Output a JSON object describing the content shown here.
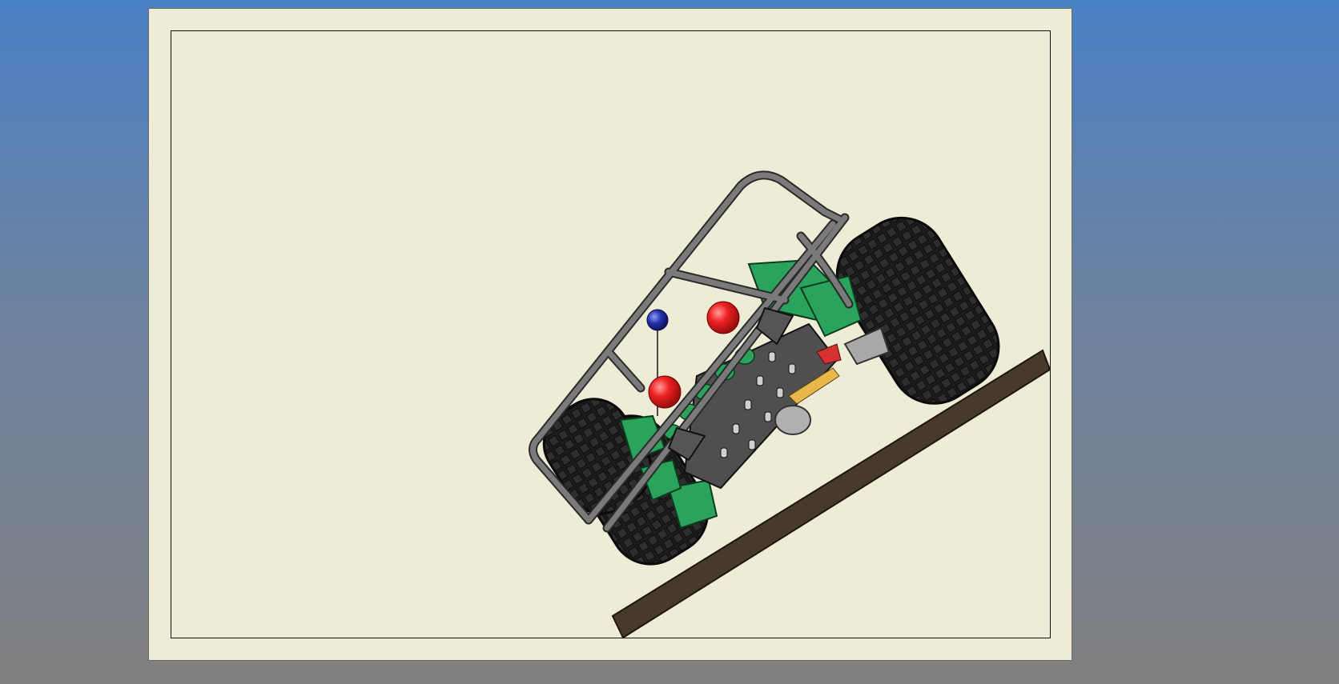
{
  "app": {
    "view": "drawing-sheet"
  },
  "colors": {
    "background_top": "#4a80c4",
    "background_bottom": "#808080",
    "sheet": "#eeecd6",
    "frame_line": "#111111",
    "ramp": "#473a2a",
    "tire": "#1c1c1c",
    "roll_cage": "#7a7a7a",
    "chassis_plate": "#4f4f4f",
    "component_green": "#2aa35c",
    "cg_marker_red": "#e52020",
    "cg_marker_blue": "#2233aa"
  },
  "drawing": {
    "subject": "off-road-buggy-on-incline",
    "icons": [
      "tire-icon",
      "roll-cage-icon",
      "chassis-icon",
      "ramp-icon",
      "center-of-gravity-marker-icon"
    ]
  }
}
